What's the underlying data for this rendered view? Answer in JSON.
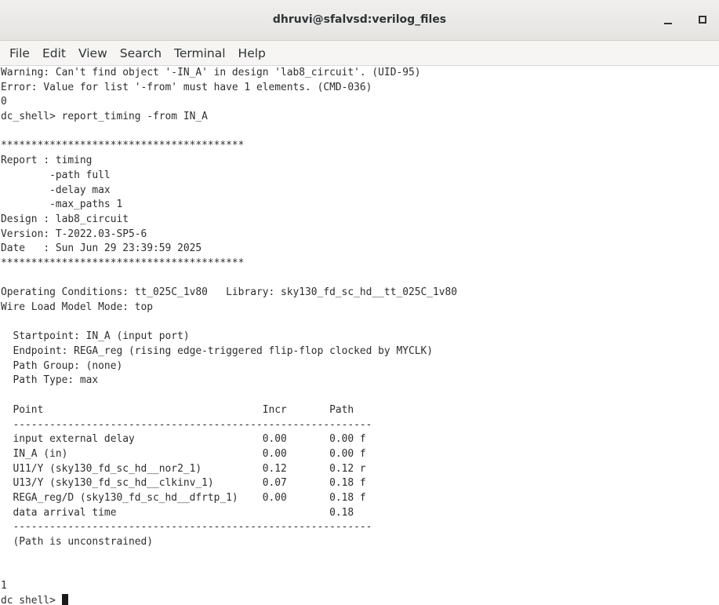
{
  "window": {
    "title": "dhruvi@sfalvsd:verilog_files"
  },
  "menu": {
    "items": [
      "File",
      "Edit",
      "View",
      "Search",
      "Terminal",
      "Help"
    ]
  },
  "terminal": {
    "lines": [
      "Warning: Can't find object '-IN_A' in design 'lab8_circuit'. (UID-95)",
      "Error: Value for list '-from' must have 1 elements. (CMD-036)",
      "0",
      "dc_shell> report_timing -from IN_A",
      "",
      "****************************************",
      "Report : timing",
      "        -path full",
      "        -delay max",
      "        -max_paths 1",
      "Design : lab8_circuit",
      "Version: T-2022.03-SP5-6",
      "Date   : Sun Jun 29 23:39:59 2025",
      "****************************************",
      "",
      "Operating Conditions: tt_025C_1v80   Library: sky130_fd_sc_hd__tt_025C_1v80",
      "Wire Load Model Mode: top",
      "",
      "  Startpoint: IN_A (input port)",
      "  Endpoint: REGA_reg (rising edge-triggered flip-flop clocked by MYCLK)",
      "  Path Group: (none)",
      "  Path Type: max",
      "",
      "  Point                                    Incr       Path",
      "  -----------------------------------------------------------",
      "  input external delay                     0.00       0.00 f",
      "  IN_A (in)                                0.00       0.00 f",
      "  U11/Y (sky130_fd_sc_hd__nor2_1)          0.12       0.12 r",
      "  U13/Y (sky130_fd_sc_hd__clkinv_1)        0.07       0.18 f",
      "  REGA_reg/D (sky130_fd_sc_hd__dfrtp_1)    0.00       0.18 f",
      "  data arrival time                                   0.18",
      "  -----------------------------------------------------------",
      "  (Path is unconstrained)",
      "",
      "",
      "1"
    ],
    "prompt": "dc_shell> "
  }
}
